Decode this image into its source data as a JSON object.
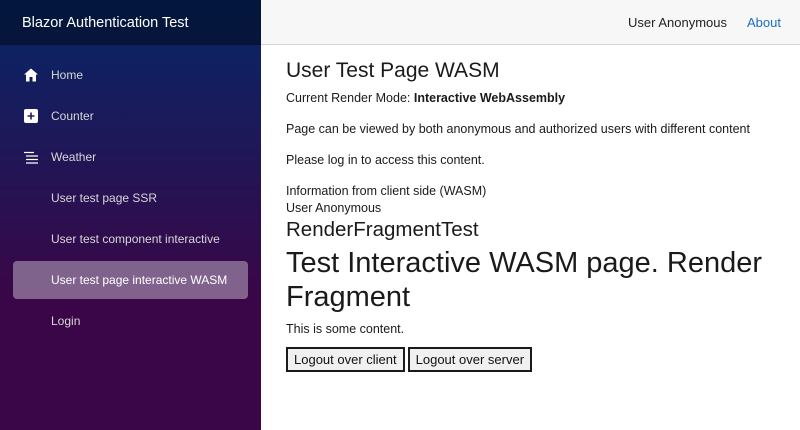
{
  "brand": {
    "title": "Blazor Authentication Test"
  },
  "nav": {
    "home": {
      "label": "Home",
      "icon": "home-icon"
    },
    "counter": {
      "label": "Counter",
      "icon": "plus-square-icon"
    },
    "weather": {
      "label": "Weather",
      "icon": "list-icon"
    },
    "user_ssr": {
      "label": "User test page SSR"
    },
    "user_component": {
      "label": "User test component interactive"
    },
    "user_wasm": {
      "label": "User test page interactive WASM"
    },
    "login": {
      "label": "Login"
    }
  },
  "topbar": {
    "user": "User Anonymous",
    "about": "About"
  },
  "main": {
    "title": "User Test Page WASM",
    "render_mode_label": "Current Render Mode: ",
    "render_mode_value": "Interactive WebAssembly",
    "viewable_text": "Page can be viewed by both anonymous and authorized users with different content",
    "login_prompt": "Please log in to access this content.",
    "client_info": "Information from client side (WASM)",
    "client_user": "User Anonymous",
    "fragment_heading": "RenderFragmentTest",
    "fragment_title": "Test Interactive WASM page. Render Fragment",
    "fragment_content": "This is some content.",
    "logout_client": "Logout over client",
    "logout_server": "Logout over server"
  },
  "colors": {
    "sidebar_top": "#052767",
    "sidebar_bottom": "#3a0647",
    "link": "#1b6ec2",
    "topbar_bg": "#f7f7f7"
  }
}
